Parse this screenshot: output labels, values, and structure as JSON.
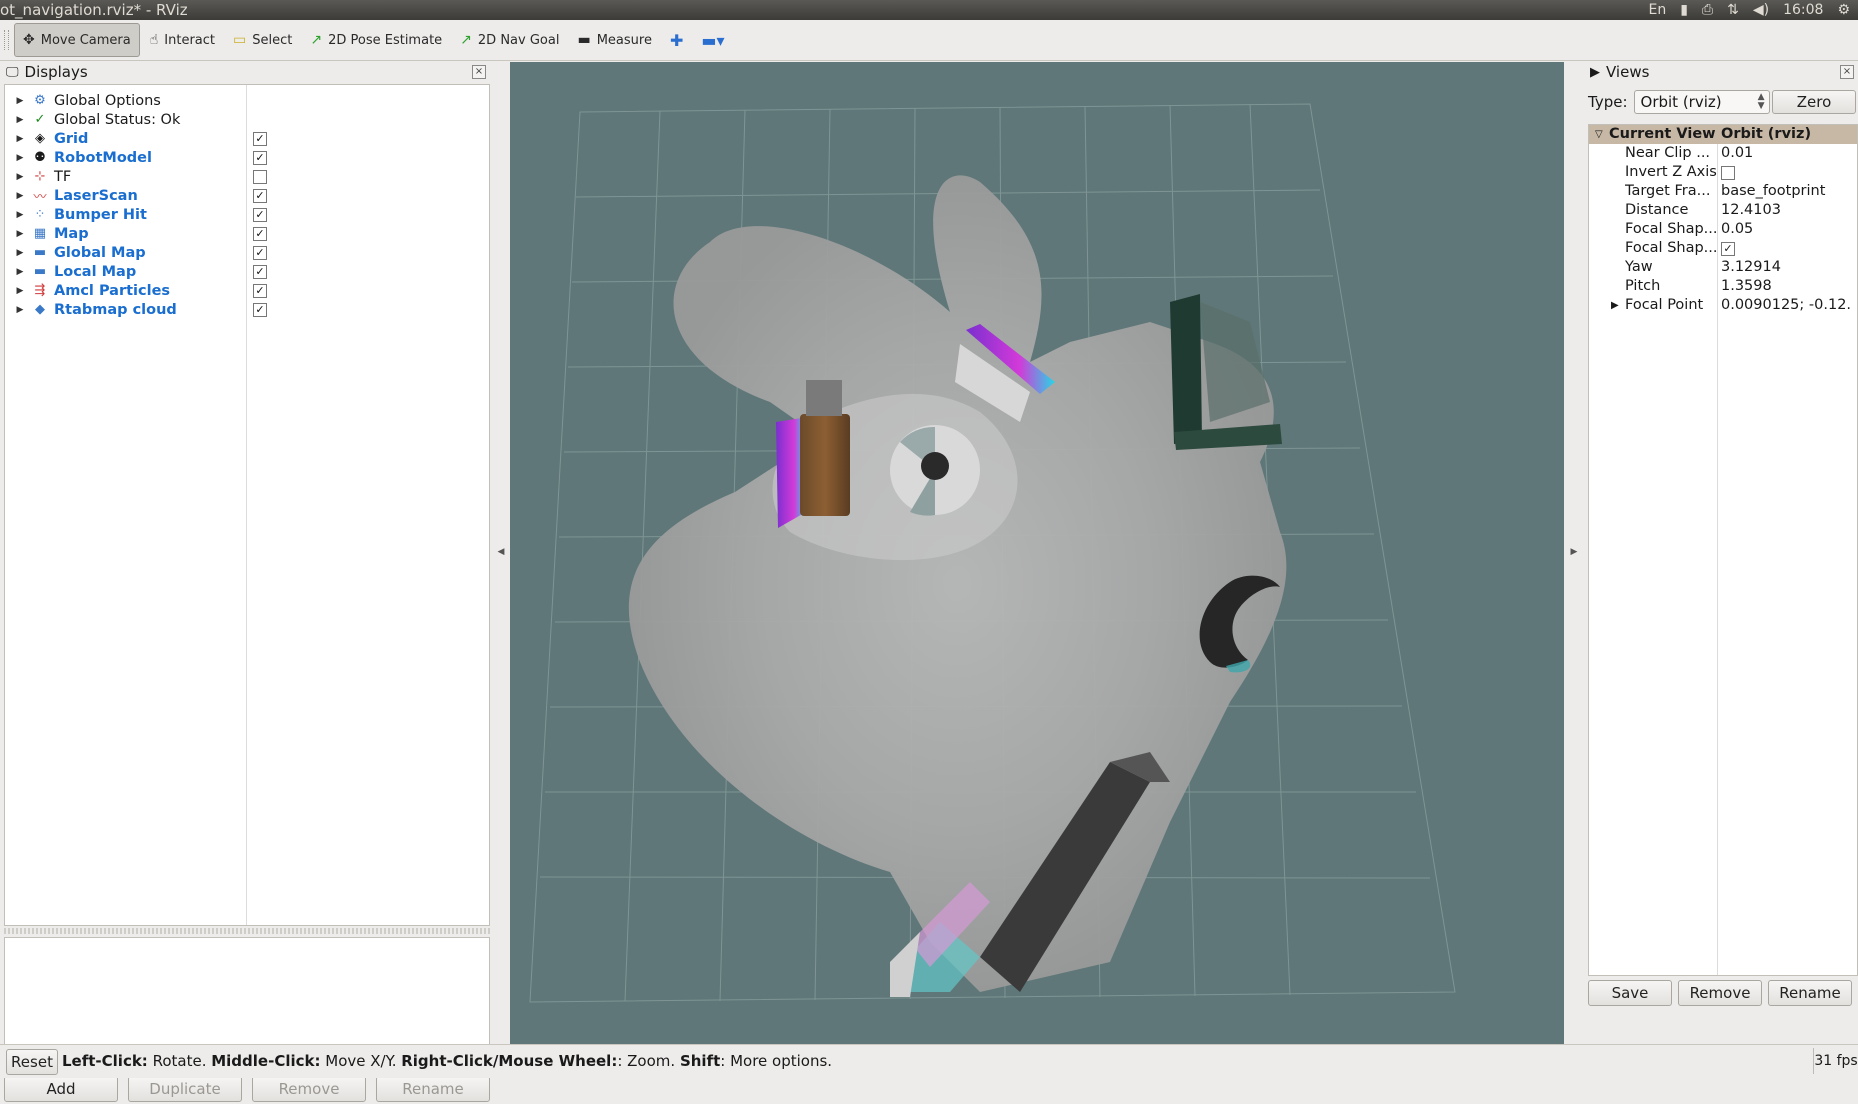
{
  "window": {
    "title": "ot_navigation.rviz* - RViz"
  },
  "tray": {
    "lang": "En",
    "time": "16:08"
  },
  "toolbar": {
    "tools": [
      {
        "label": "Move Camera",
        "icon": "move-camera-icon",
        "glyph": "✥"
      },
      {
        "label": "Interact",
        "icon": "interact-hand-icon",
        "glyph": "☝"
      },
      {
        "label": "Select",
        "icon": "select-box-icon",
        "glyph": "▭"
      },
      {
        "label": "2D Pose Estimate",
        "icon": "pose-estimate-arrow-icon",
        "glyph": "↗"
      },
      {
        "label": "2D Nav Goal",
        "icon": "nav-goal-arrow-icon",
        "glyph": "↗"
      },
      {
        "label": "Measure",
        "icon": "ruler-icon",
        "glyph": "▬"
      }
    ]
  },
  "displays": {
    "title": "Displays",
    "items": [
      {
        "label": "Global Options",
        "icon": "gear-icon",
        "glyph": "⚙",
        "checkbox": null,
        "blue": false
      },
      {
        "label": "Global Status: Ok",
        "icon": "check-icon",
        "glyph": "✓",
        "checkbox": null,
        "blue": false
      },
      {
        "label": "Grid",
        "icon": "grid-icon",
        "glyph": "◈",
        "checkbox": true,
        "blue": true
      },
      {
        "label": "RobotModel",
        "icon": "robot-icon",
        "glyph": "⚉",
        "checkbox": true,
        "blue": true
      },
      {
        "label": "TF",
        "icon": "tf-axes-icon",
        "glyph": "⊹",
        "checkbox": false,
        "blue": false
      },
      {
        "label": "LaserScan",
        "icon": "laser-scan-icon",
        "glyph": "〰",
        "checkbox": true,
        "blue": true
      },
      {
        "label": "Bumper Hit",
        "icon": "points-icon",
        "glyph": "⁘",
        "checkbox": true,
        "blue": true
      },
      {
        "label": "Map",
        "icon": "map-icon",
        "glyph": "▦",
        "checkbox": true,
        "blue": true
      },
      {
        "label": "Global Map",
        "icon": "folder-icon",
        "glyph": "▬",
        "checkbox": true,
        "blue": true
      },
      {
        "label": "Local Map",
        "icon": "folder-icon",
        "glyph": "▬",
        "checkbox": true,
        "blue": true
      },
      {
        "label": "Amcl Particles",
        "icon": "pose-array-icon",
        "glyph": "⇶",
        "checkbox": true,
        "blue": true
      },
      {
        "label": "Rtabmap cloud",
        "icon": "cloud-icon",
        "glyph": "◆",
        "checkbox": true,
        "blue": true
      }
    ],
    "buttons": {
      "add": "Add",
      "duplicate": "Duplicate",
      "remove": "Remove",
      "rename": "Rename"
    }
  },
  "views": {
    "title": "Views",
    "type_label": "Type:",
    "type_value": "Orbit (rviz)",
    "zero": "Zero",
    "current_view": {
      "name": "Current View",
      "value": "Orbit (rviz)"
    },
    "props": [
      {
        "name": "Near Clip ...",
        "value": "0.01",
        "checkbox": null,
        "expandable": false
      },
      {
        "name": "Invert Z Axis",
        "value": "",
        "checkbox": false,
        "expandable": false
      },
      {
        "name": "Target Fra...",
        "value": "base_footprint",
        "checkbox": null,
        "expandable": false
      },
      {
        "name": "Distance",
        "value": "12.4103",
        "checkbox": null,
        "expandable": false
      },
      {
        "name": "Focal Shap...",
        "value": "0.05",
        "checkbox": null,
        "expandable": false
      },
      {
        "name": "Focal Shap...",
        "value": "",
        "checkbox": true,
        "expandable": false
      },
      {
        "name": "Yaw",
        "value": "3.12914",
        "checkbox": null,
        "expandable": false
      },
      {
        "name": "Pitch",
        "value": "1.3598",
        "checkbox": null,
        "expandable": false
      },
      {
        "name": "Focal Point",
        "value": "0.0090125; -0.12...",
        "checkbox": null,
        "expandable": true
      }
    ],
    "buttons": {
      "save": "Save",
      "remove": "Remove",
      "rename": "Rename"
    }
  },
  "status": {
    "reset": "Reset",
    "parts": [
      {
        "k": "Left-Click:",
        "v": " Rotate. "
      },
      {
        "k": "Middle-Click:",
        "v": " Move X/Y. "
      },
      {
        "k": "Right-Click/Mouse Wheel:",
        "v": ": Zoom. "
      },
      {
        "k": "Shift",
        "v": ": More options."
      }
    ],
    "fps": "31 fps"
  }
}
